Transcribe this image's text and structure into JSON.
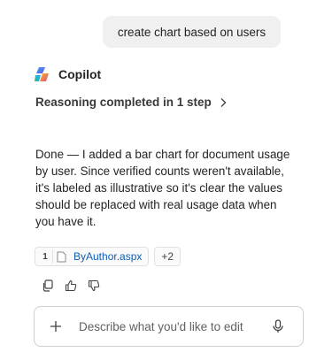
{
  "chat": {
    "user_message": "create chart based on users",
    "assistant_name": "Copilot",
    "reasoning_label": "Reasoning completed in 1 step",
    "response_text": "Done — I added a bar chart for document usage by user. Since verified counts weren't available, it's labeled as illustrative so it's clear the values should be replaced with real usage data when you have it.",
    "references": [
      {
        "index": "1",
        "name": "ByAuthor.aspx",
        "icon": "file-icon"
      }
    ],
    "more_references": "+2",
    "actions": [
      "copy-icon",
      "thumbs-up-icon",
      "thumbs-down-icon"
    ]
  },
  "composer": {
    "placeholder": "Describe what you'd like to edit",
    "add_icon": "plus-icon",
    "mic_icon": "microphone-icon"
  },
  "colors": {
    "link": "#0f5fb8",
    "bubble": "#f0f0f0",
    "text": "#242424"
  }
}
